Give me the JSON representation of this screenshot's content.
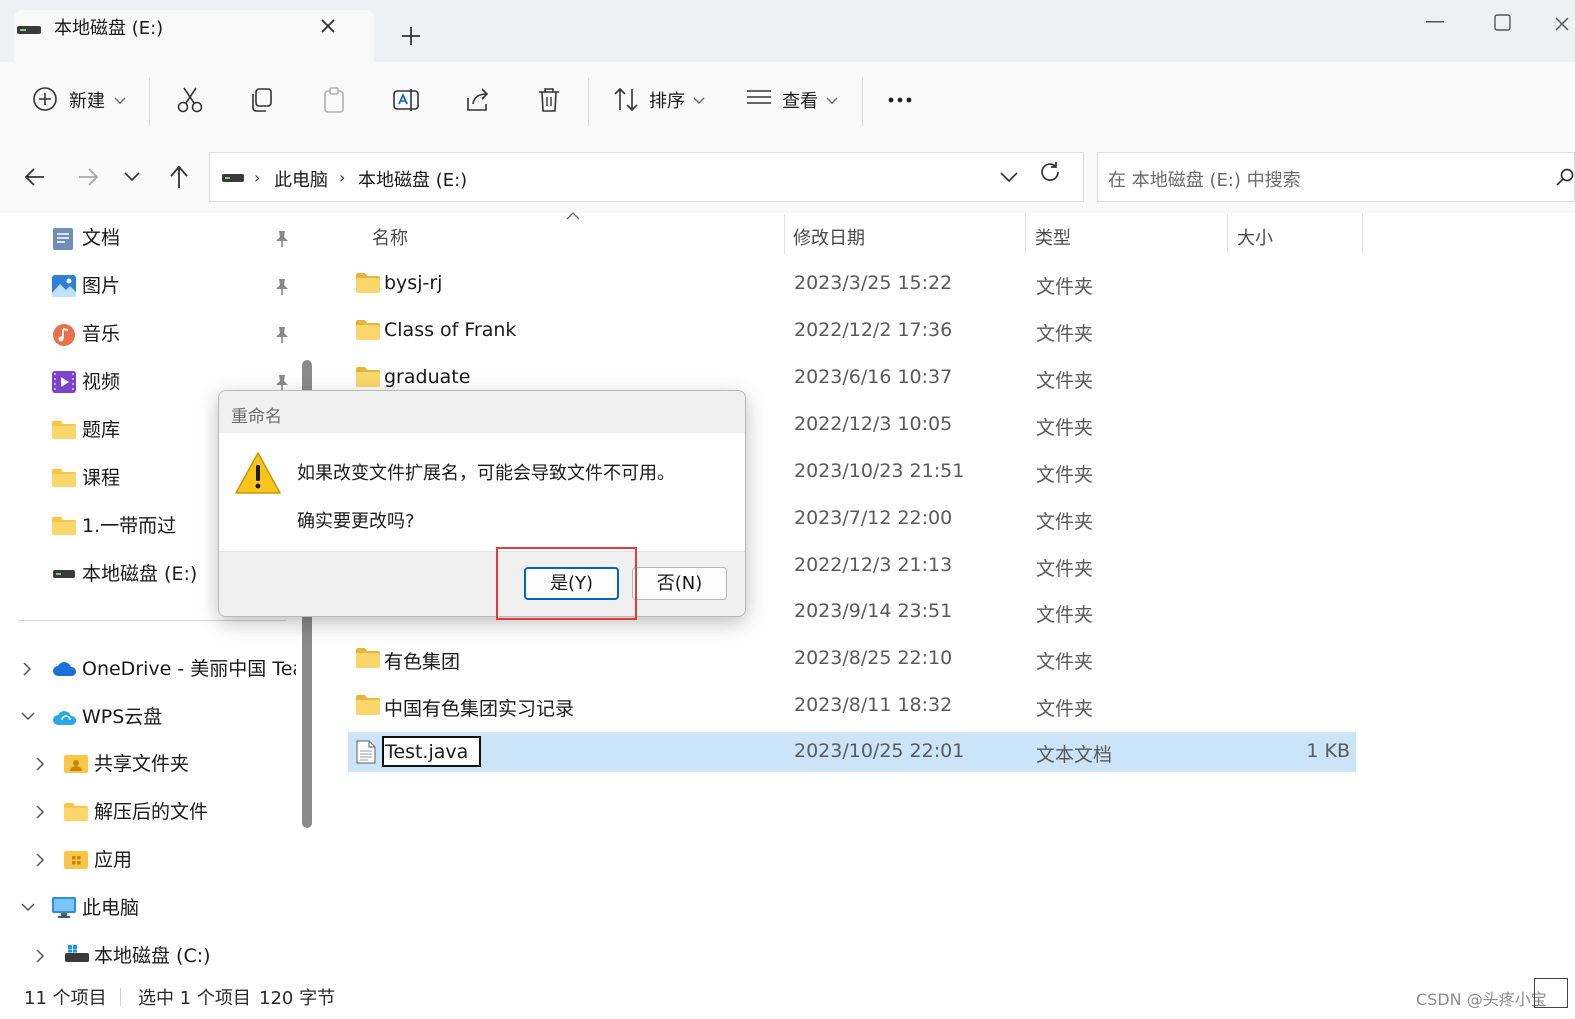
{
  "tab": {
    "title": "本地磁盘 (E:)"
  },
  "toolbar": {
    "new_label": "新建",
    "sort_label": "排序",
    "view_label": "查看"
  },
  "address": {
    "crumbs": [
      "此电脑",
      "本地磁盘 (E:)"
    ]
  },
  "search": {
    "placeholder": "在 本地磁盘 (E:) 中搜索"
  },
  "sidebar": {
    "quick": [
      {
        "label": "文档",
        "icon": "document-icon",
        "pinned": true
      },
      {
        "label": "图片",
        "icon": "pictures-icon",
        "pinned": true
      },
      {
        "label": "音乐",
        "icon": "music-icon",
        "pinned": true
      },
      {
        "label": "视频",
        "icon": "video-icon",
        "pinned": true
      },
      {
        "label": "题库",
        "icon": "folder-icon"
      },
      {
        "label": "课程",
        "icon": "folder-icon"
      },
      {
        "label": "1.一带而过",
        "icon": "folder-icon"
      },
      {
        "label": "本地磁盘 (E:)",
        "icon": "drive-icon"
      }
    ],
    "tree": [
      {
        "label": "OneDrive - 美丽中国 Teac",
        "icon": "onedrive-icon",
        "state": "collapsed"
      },
      {
        "label": "WPS云盘",
        "icon": "wps-cloud-icon",
        "state": "expanded"
      },
      {
        "label": "共享文件夹",
        "icon": "shared-folder-icon",
        "state": "collapsed"
      },
      {
        "label": "解压后的文件",
        "icon": "folder-icon",
        "state": "collapsed"
      },
      {
        "label": "应用",
        "icon": "apps-folder-icon",
        "state": "collapsed"
      },
      {
        "label": "此电脑",
        "icon": "pc-icon",
        "state": "expanded"
      },
      {
        "label": "本地磁盘 (C:)",
        "icon": "drive-icon",
        "state": "collapsed"
      }
    ]
  },
  "columns": {
    "name": "名称",
    "date": "修改日期",
    "type": "类型",
    "size": "大小"
  },
  "files": [
    {
      "name": "bysj-rj",
      "date": "2023/3/25 15:22",
      "type": "文件夹",
      "size": ""
    },
    {
      "name": "Class of Frank",
      "date": "2022/12/2 17:36",
      "type": "文件夹",
      "size": ""
    },
    {
      "name": "graduate",
      "date": "2023/6/16 10:37",
      "type": "文件夹",
      "size": ""
    },
    {
      "name": "",
      "date": "2022/12/3 10:05",
      "type": "文件夹",
      "size": ""
    },
    {
      "name": "",
      "date": "2023/10/23 21:51",
      "type": "文件夹",
      "size": ""
    },
    {
      "name": "",
      "date": "2023/7/12 22:00",
      "type": "文件夹",
      "size": ""
    },
    {
      "name": "",
      "date": "2022/12/3 21:13",
      "type": "文件夹",
      "size": ""
    },
    {
      "name": "",
      "date": "2023/9/14 23:51",
      "type": "文件夹",
      "size": ""
    },
    {
      "name": "有色集团",
      "date": "2023/8/25 22:10",
      "type": "文件夹",
      "size": ""
    },
    {
      "name": "中国有色集团实习记录",
      "date": "2023/8/11 18:32",
      "type": "文件夹",
      "size": ""
    },
    {
      "name": "Test.java",
      "date": "2023/10/25 22:01",
      "type": "文本文档",
      "size": "1 KB",
      "selected": true
    }
  ],
  "status": {
    "count": "11 个项目",
    "selection": "选中 1 个项目",
    "bytes": "120 字节"
  },
  "watermark": "CSDN @头疼小宝",
  "dialog": {
    "title": "重命名",
    "message": "如果改变文件扩展名，可能会导致文件不可用。",
    "question": "确实要更改吗?",
    "yes": "是(Y)",
    "no": "否(N)"
  },
  "colors": {
    "accent": "#0067c0",
    "selection": "#cce4f7",
    "folder": "#f7c548",
    "highlight": "#e23b3b"
  }
}
